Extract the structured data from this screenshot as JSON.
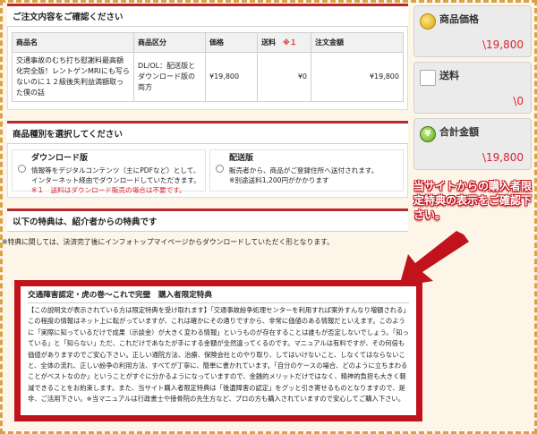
{
  "order": {
    "heading": "ご注文内容をご確認ください",
    "columns": [
      "商品名",
      "商品区分",
      "価格",
      "送料",
      "※１",
      "注文金額"
    ],
    "row": {
      "name": "交通事故のむち打ち慰謝料最高額化完全版！レントゲンMRIにも写らないのに１２級後失利益満額取った僕の話",
      "type": "DL/OL：配送版とダウンロード版の両方",
      "price": "¥19,800",
      "shipping": "¥0",
      "total": "¥19,800"
    }
  },
  "product_type": {
    "heading": "商品種別を選択してください",
    "download": {
      "title": "ダウンロード版",
      "desc": "情報等をデジタルコンテンツ（主にPDFなど）として、インターネット経由でダウンロードしていただきます。",
      "note": "※１　送料はダウンロード販売の場合は不要です。"
    },
    "delivery": {
      "title": "配送版",
      "desc": "販売者から、商品がご登録住所へ送付されます。",
      "note": "※別途送料1,200円がかかります"
    }
  },
  "bonus": {
    "heading": "以下の特典は、紹介者からの特典です",
    "note": "※特典に関しては、決済完了後にインフォトップマイページからダウンロードしていただく形となります。",
    "title": "交通障害認定・虎の巻〜これで完璧　購入者限定特典",
    "body": "【この説明文が表示されている方は限定特典を受け取れます】「交通事故紛争処理センターを利用すれば案外すんなり増額される」この程度の情報はネット上に転がっていますが、これは確かにその通りですから、非常に価値のある情報だといえます。このように「実際に知っているだけで成果（示談金）が大きく変わる情報」というものが存在することは誰もが否定しないでしょう。「知っている」と「知らない」ただ、これだけであなたが手にする金額が全然違ってくるのです。マニュアルは有料ですが、その何倍も価値がありますのでご安心下さい。正しい通院方法、治療、保険会社とのやり取り、してはいけないこと、しなくてはならないこと、全体の流れ、正しい紛争の利用方法、すべてが丁寧に、簡単に書かれています。「自分のケースの場合、どのように立ちまわることがベストなのか」ということがすぐに分かるようになっていますので、金銭的メリットだけではなく、精神的負担も大きく軽減できることをお約束します。また、当サイト購入者限定特典は「後遺障害の認定」をグッと引き寄せるものとなりますので、是非、ご活用下さい。※当マニュアルは行政書士や接骨院の先生方など、プロの方も購入されていますので安心してご購入下さい。"
  },
  "summary": {
    "price_label": "商品価格",
    "price_value": "\\19,800",
    "shipping_label": "送料",
    "shipping_value": "\\0",
    "total_label": "合計金額",
    "total_value": "\\19,800",
    "yen_glyph": "¥"
  },
  "callout": "当サイトからの購入者限定特典の表示をご確認下さい。",
  "colors": {
    "accent_red": "#c0131c",
    "price_red": "#d8262d",
    "frame": "#d9a24a"
  }
}
